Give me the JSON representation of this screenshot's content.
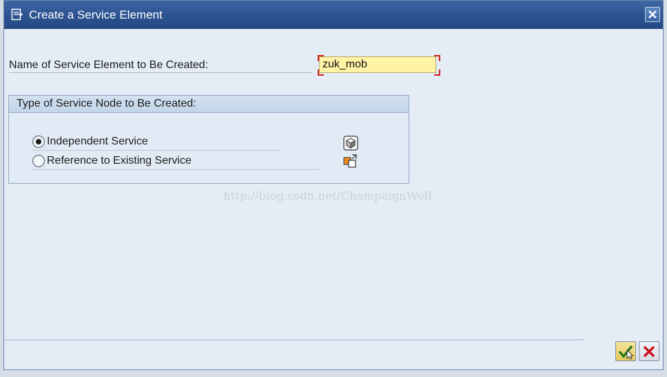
{
  "window": {
    "title": "Create a Service Element",
    "title_icon": "create-document-icon",
    "close_icon": "close-icon"
  },
  "form": {
    "name_label": "Name of Service Element to Be Created:",
    "name_value": "zuk_mob"
  },
  "service_type_group": {
    "title": "Type of Service Node to Be Created:",
    "options": [
      {
        "label": "Independent Service",
        "selected": true,
        "icon": "service-cube-icon"
      },
      {
        "label": "Reference to Existing Service",
        "selected": false,
        "icon": "reference-service-icon"
      }
    ]
  },
  "watermark": "http://blog.csdn.net/ChampaignWolf",
  "footer": {
    "confirm_icon": "checkmark-confirm-icon",
    "cancel_icon": "cancel-x-icon"
  },
  "colors": {
    "title_bar": "#2c5290",
    "input_background": "#fff3a6",
    "required_marker": "#d0201a",
    "confirm_button": "#e6c95d",
    "cancel_red": "#c8101c"
  }
}
